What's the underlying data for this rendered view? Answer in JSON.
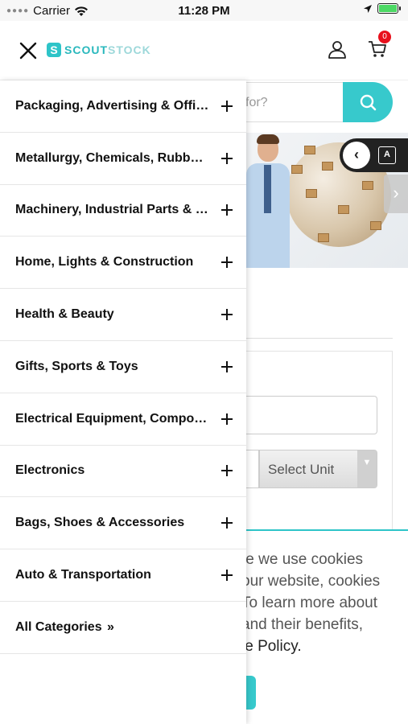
{
  "status_bar": {
    "carrier": "Carrier",
    "time": "11:28 PM",
    "battery_color": "#4cd964"
  },
  "header": {
    "logo_mark": "S",
    "logo_text_a": "SCOUT",
    "logo_text_b": "STOCK",
    "cart_count": "0",
    "brand_color": "#2ec4c8"
  },
  "background_page": {
    "search_placeholder_fragment": "for?",
    "unit_select_value": "Select Unit",
    "cookie_lines": [
      "te we use cookies",
      "our website, cookies",
      "To learn more about",
      " and their benefits,",
      "ie Policy."
    ],
    "lang_icon_text": "A"
  },
  "drawer": {
    "items": [
      {
        "label": "Packaging, Advertising & Office"
      },
      {
        "label": "Metallurgy, Chemicals, Rubber & Plastics"
      },
      {
        "label": "Machinery, Industrial Parts & Tools"
      },
      {
        "label": "Home, Lights & Construction"
      },
      {
        "label": "Health & Beauty"
      },
      {
        "label": "Gifts, Sports & Toys"
      },
      {
        "label": "Electrical Equipment, Components & Telecoms"
      },
      {
        "label": "Electronics"
      },
      {
        "label": "Bags, Shoes & Accessories"
      },
      {
        "label": "Auto & Transportation"
      }
    ],
    "all_categories": "All Categories",
    "all_categories_chevron": "»"
  }
}
